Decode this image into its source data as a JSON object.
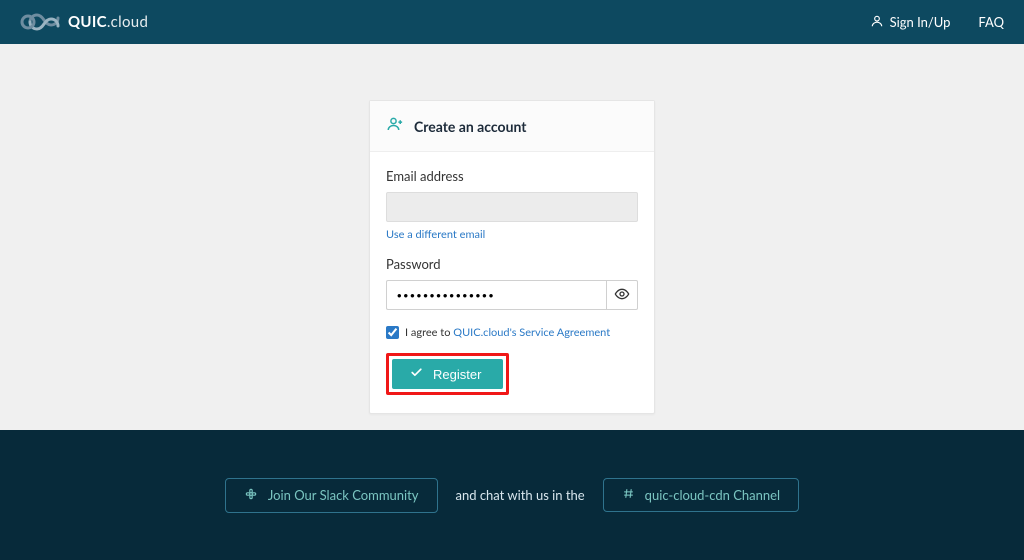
{
  "header": {
    "brand_bold": "QUIC",
    "brand_light": ".cloud",
    "signin": "Sign In/Up",
    "faq": "FAQ"
  },
  "card": {
    "title": "Create an account",
    "email_label": "Email address",
    "email_value": "",
    "diff_email": "Use a different email",
    "password_label": "Password",
    "password_value": "•••••••••••••••",
    "agree_prefix": "I agree to ",
    "agree_link": "QUIC.cloud's Service Agreement",
    "register": "Register"
  },
  "footer": {
    "slack": "Join Our Slack Community",
    "mid": "and chat with us in the",
    "channel": "quic-cloud-cdn Channel"
  }
}
